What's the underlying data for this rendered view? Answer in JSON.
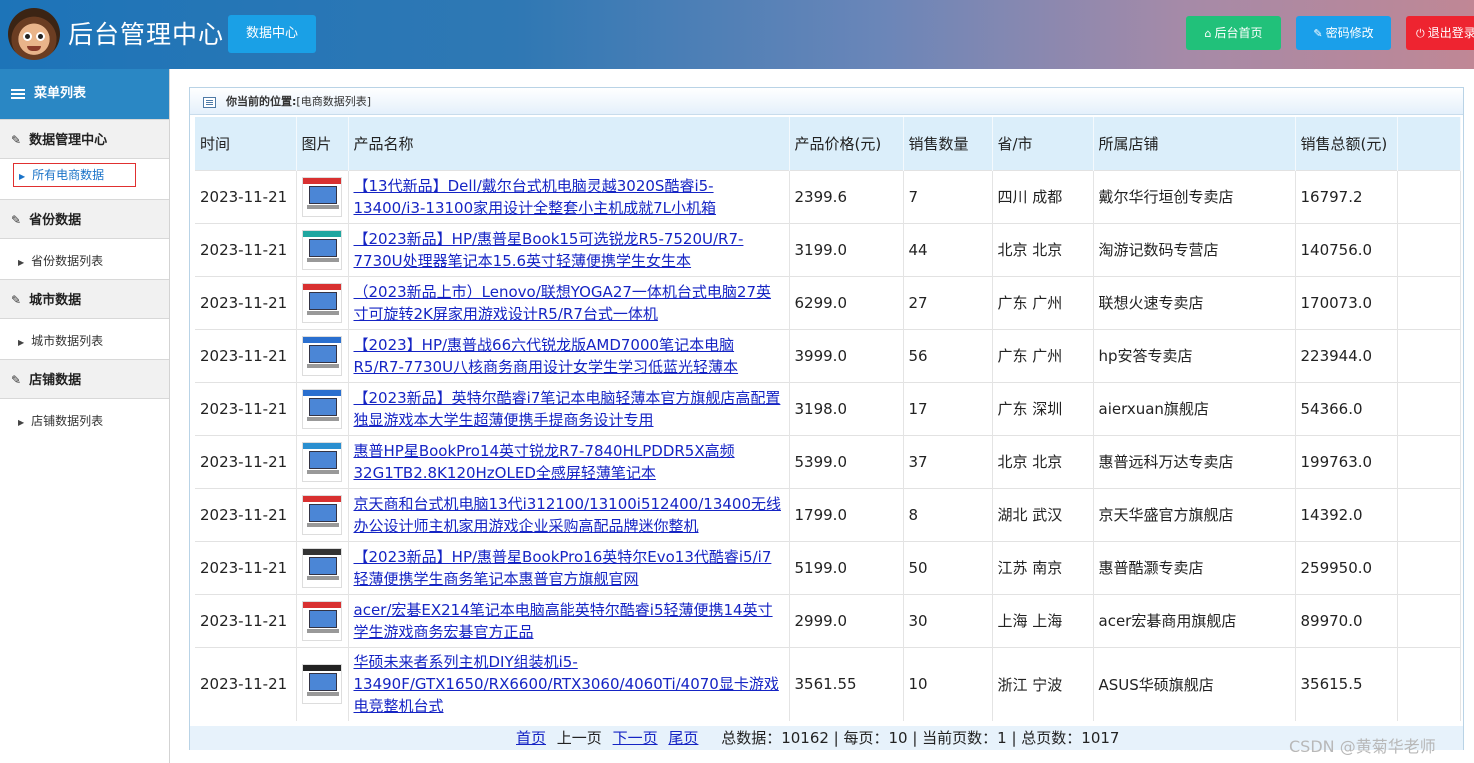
{
  "header": {
    "app_title": "后台管理中心",
    "data_center_label": "数据中心",
    "home_label": "后台首页",
    "password_label": "密码修改",
    "logout_label": "退出登录",
    "home_color": "#21c17a",
    "password_color": "#1a9fea",
    "logout_color": "#ee2430"
  },
  "sidebar": {
    "menu_title": "菜单列表",
    "groups": [
      {
        "title": "数据管理中心",
        "item": "所有电商数据",
        "active": true
      },
      {
        "title": "省份数据",
        "item": "省份数据列表",
        "active": false
      },
      {
        "title": "城市数据",
        "item": "城市数据列表",
        "active": false
      },
      {
        "title": "店铺数据",
        "item": "店铺数据列表",
        "active": false
      }
    ]
  },
  "breadcrumb": {
    "prefix": "你当前的位置:",
    "current": "[电商数据列表]"
  },
  "table": {
    "columns": [
      "时间",
      "图片",
      "产品名称",
      "产品价格(元)",
      "销售数量",
      "省/市",
      "所属店铺",
      "销售总额(元)"
    ],
    "rows": [
      {
        "time": "2023-11-21",
        "name": "【13代新品】Dell/戴尔台式机电脑灵越3020S酷睿i5-13400/i3-13100家用设计全整套小主机成就7L小机箱",
        "price": "2399.6",
        "qty": "7",
        "region": "四川 成都",
        "shop": "戴尔华行垣创专卖店",
        "total": "16797.2"
      },
      {
        "time": "2023-11-21",
        "name": "【2023新品】HP/惠普星Book15可选锐龙R5-7520U/R7-7730U处理器笔记本15.6英寸轻薄便携学生女生本",
        "price": "3199.0",
        "qty": "44",
        "region": "北京 北京",
        "shop": "淘游记数码专营店",
        "total": "140756.0"
      },
      {
        "time": "2023-11-21",
        "name": "（2023新品上市）Lenovo/联想YOGA27一体机台式电脑27英寸可旋转2K屏家用游戏设计R5/R7台式一体机",
        "price": "6299.0",
        "qty": "27",
        "region": "广东 广州",
        "shop": "联想火速专卖店",
        "total": "170073.0"
      },
      {
        "time": "2023-11-21",
        "name": "【2023】HP/惠普战66六代锐龙版AMD7000笔记本电脑R5/R7-7730U八核商务商用设计女学生学习低蓝光轻薄本",
        "price": "3999.0",
        "qty": "56",
        "region": "广东 广州",
        "shop": "hp安答专卖店",
        "total": "223944.0"
      },
      {
        "time": "2023-11-21",
        "name": "【2023新品】英特尔酷睿i7笔记本电脑轻薄本官方旗舰店高配置独显游戏本大学生超薄便携手提商务设计专用",
        "price": "3198.0",
        "qty": "17",
        "region": "广东 深圳",
        "shop": "aierxuan旗舰店",
        "total": "54366.0"
      },
      {
        "time": "2023-11-21",
        "name": "惠普HP星BookPro14英寸锐龙R7-7840HLPDDR5X高频32G1TB2.8K120HzOLED全感屏轻薄笔记本",
        "price": "5399.0",
        "qty": "37",
        "region": "北京 北京",
        "shop": "惠普远科万达专卖店",
        "total": "199763.0"
      },
      {
        "time": "2023-11-21",
        "name": "京天商和台式机电脑13代i312100/13100i512400/13400无线办公设计师主机家用游戏企业采购高配品牌迷你整机",
        "price": "1799.0",
        "qty": "8",
        "region": "湖北 武汉",
        "shop": "京天华盛官方旗舰店",
        "total": "14392.0"
      },
      {
        "time": "2023-11-21",
        "name": "【2023新品】HP/惠普星BookPro16英特尔Evo13代酷睿i5/i7轻薄便携学生商务笔记本惠普官方旗舰官网",
        "price": "5199.0",
        "qty": "50",
        "region": "江苏 南京",
        "shop": "惠普酷灏专卖店",
        "total": "259950.0"
      },
      {
        "time": "2023-11-21",
        "name": "acer/宏碁EX214笔记本电脑高能英特尔酷睿i5轻薄便携14英寸学生游戏商务宏碁官方正品",
        "price": "2999.0",
        "qty": "30",
        "region": "上海 上海",
        "shop": "acer宏碁商用旗舰店",
        "total": "89970.0"
      },
      {
        "time": "2023-11-21",
        "name": "华硕未来者系列主机DIY组装机i5-13490F/GTX1650/RX6600/RTX3060/4060Ti/4070显卡游戏电竞整机台式",
        "price": "3561.55",
        "qty": "10",
        "region": "浙江 宁波",
        "shop": "ASUS华硕旗舰店",
        "total": "35615.5"
      }
    ]
  },
  "pager": {
    "first": "首页",
    "prev": "上一页",
    "next": "下一页",
    "last": "尾页",
    "stats": "总数据：10162 | 每页：10 | 当前页数：1 | 总页数：1017"
  },
  "watermark": "CSDN @黄菊华老师"
}
